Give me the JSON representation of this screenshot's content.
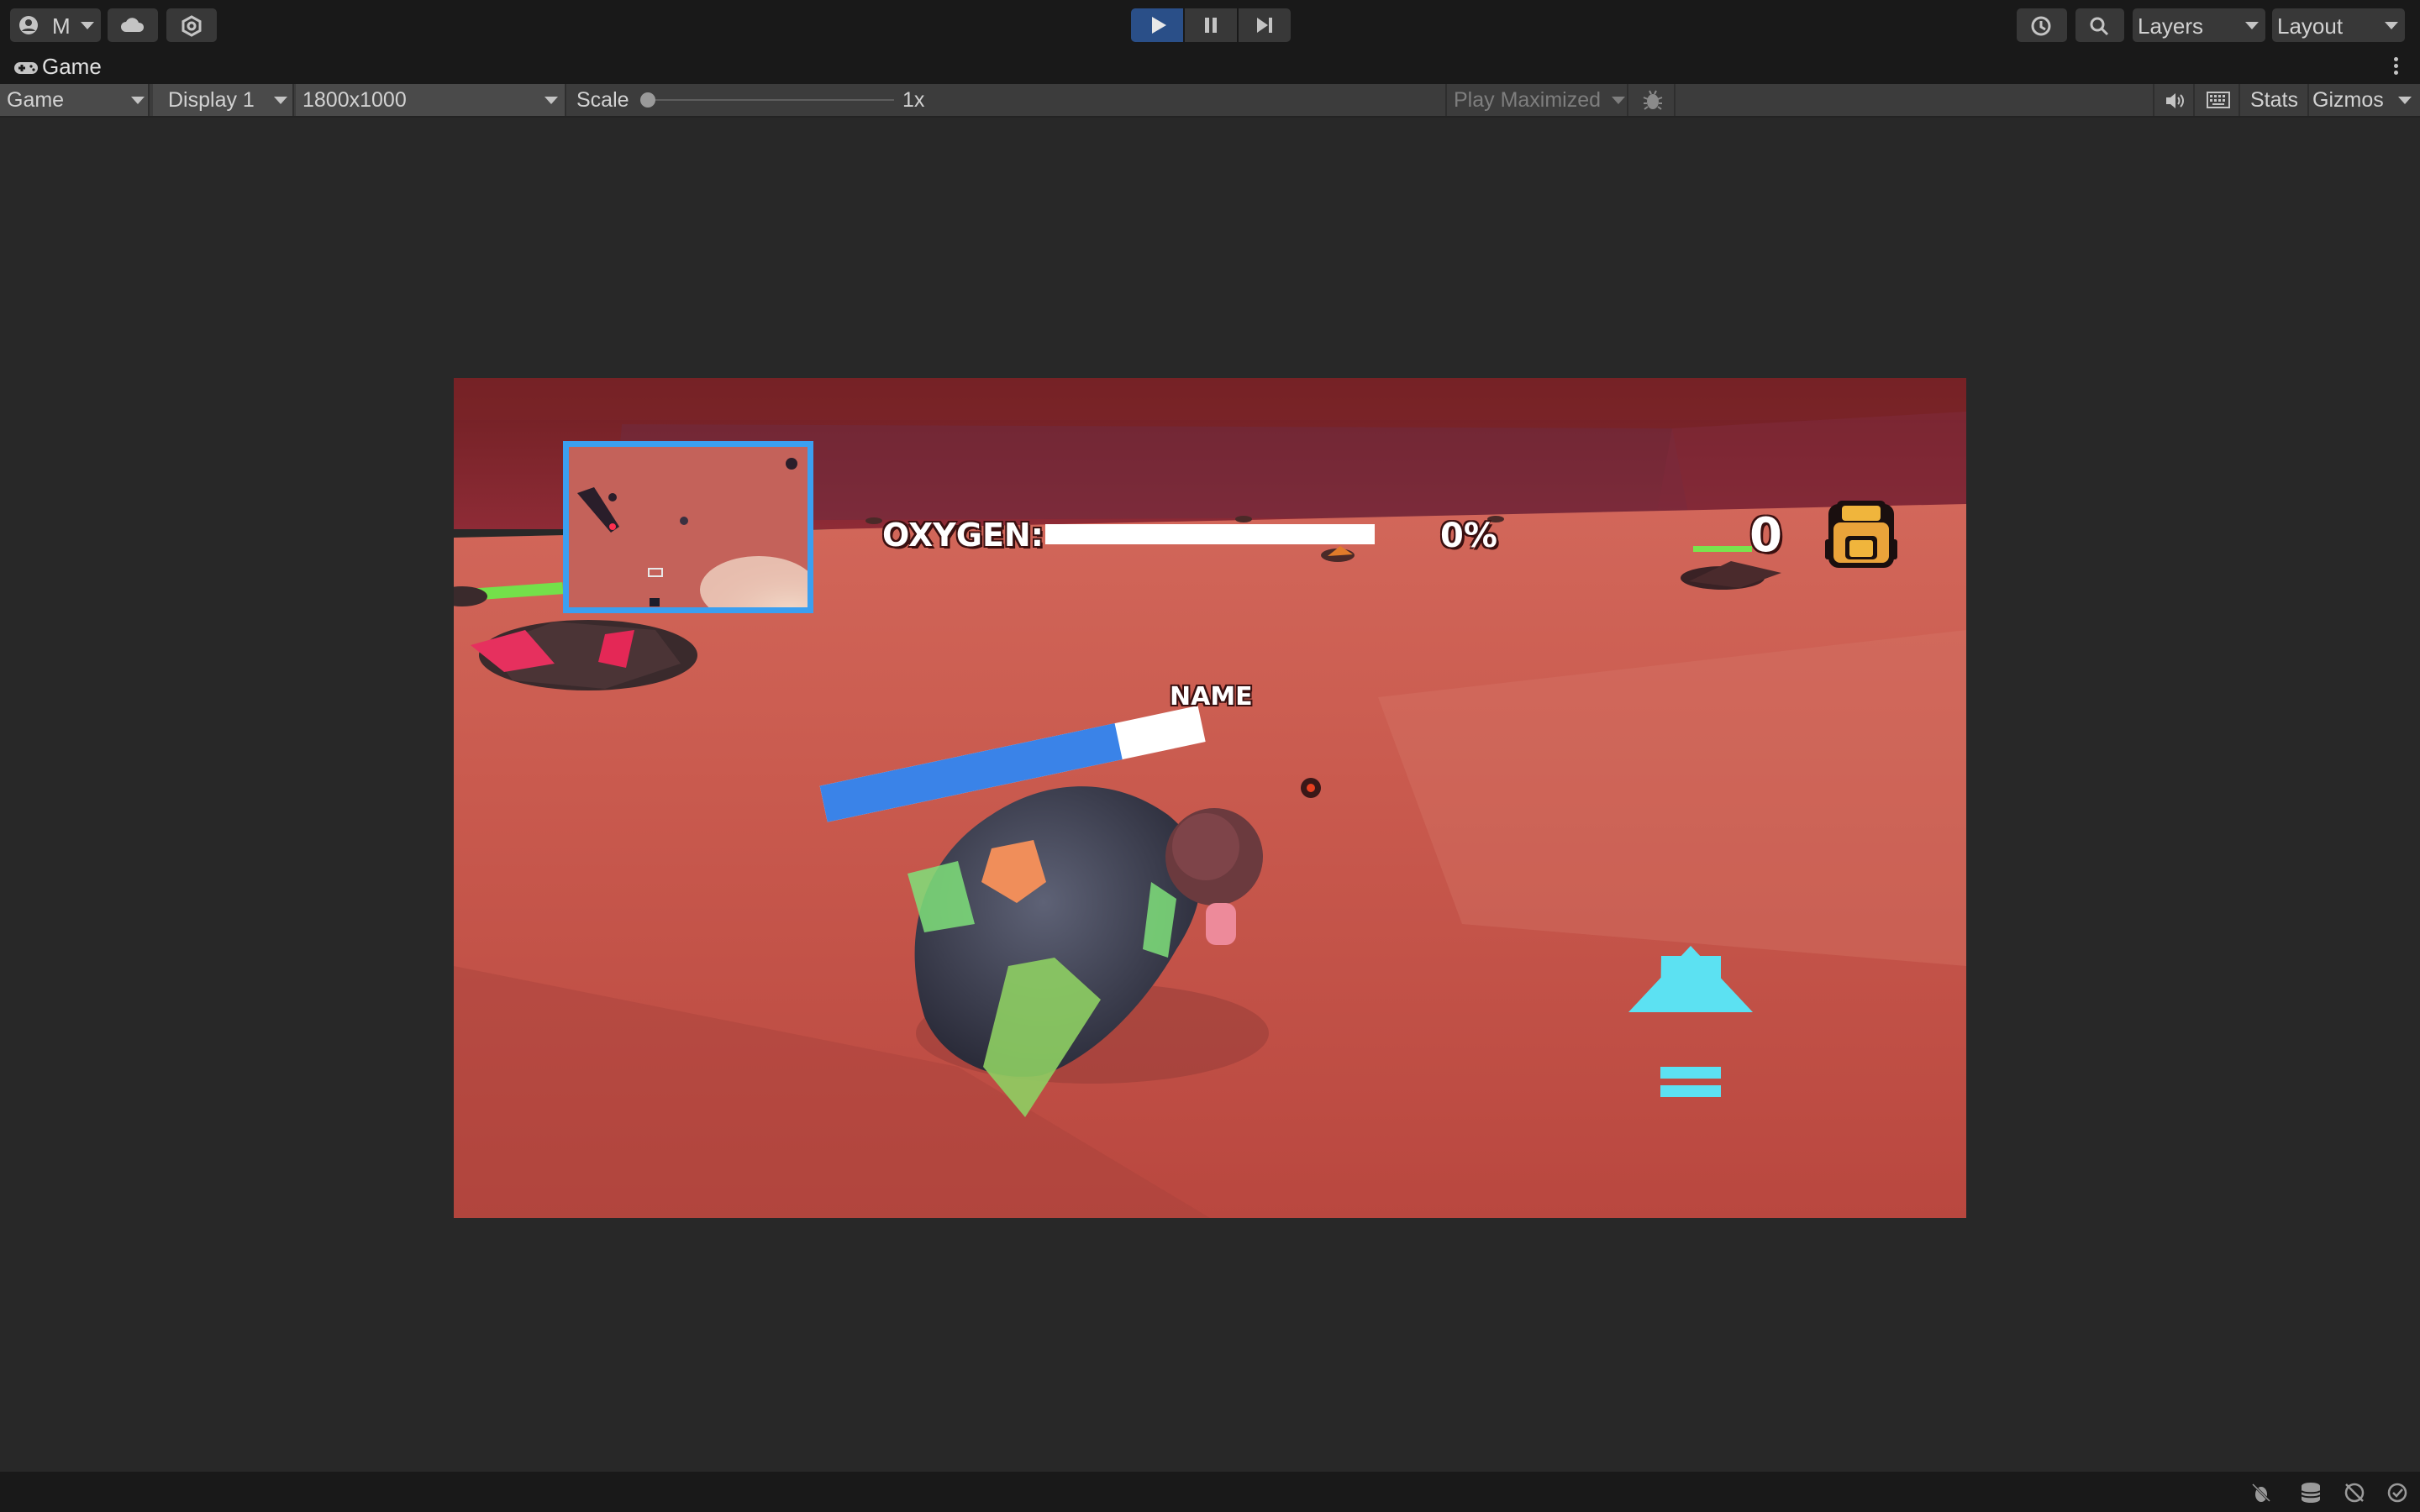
{
  "toolbar": {
    "account_label": "M",
    "layers_label": "Layers",
    "layout_label": "Layout"
  },
  "tab": {
    "label": "Game"
  },
  "gamebar": {
    "view_mode": "Game",
    "display": "Display 1",
    "resolution": "1800x1000",
    "scale_label": "Scale",
    "scale_value": "1x",
    "play_mode": "Play Maximized",
    "stats_label": "Stats",
    "gizmos_label": "Gizmos"
  },
  "hud": {
    "oxygen_label": "OXYGEN:",
    "oxygen_percent_text": "0%",
    "oxygen_level": 1.0,
    "inventory_count": "0",
    "player_name": "NAME",
    "player_bar_fill": 0.78
  },
  "colors": {
    "accent": "#2a4f88",
    "minimap_border": "#3b9ff0",
    "arrow": "#5ce1f2",
    "ground": "#cc5a4f"
  },
  "icons": [
    "account-icon",
    "cloud-icon",
    "settings-icon",
    "play-icon",
    "pause-icon",
    "step-icon",
    "history-icon",
    "search-icon",
    "audio-icon",
    "keyboard-icon",
    "bug-icon",
    "backpack-icon",
    "boost-arrow-icon"
  ]
}
